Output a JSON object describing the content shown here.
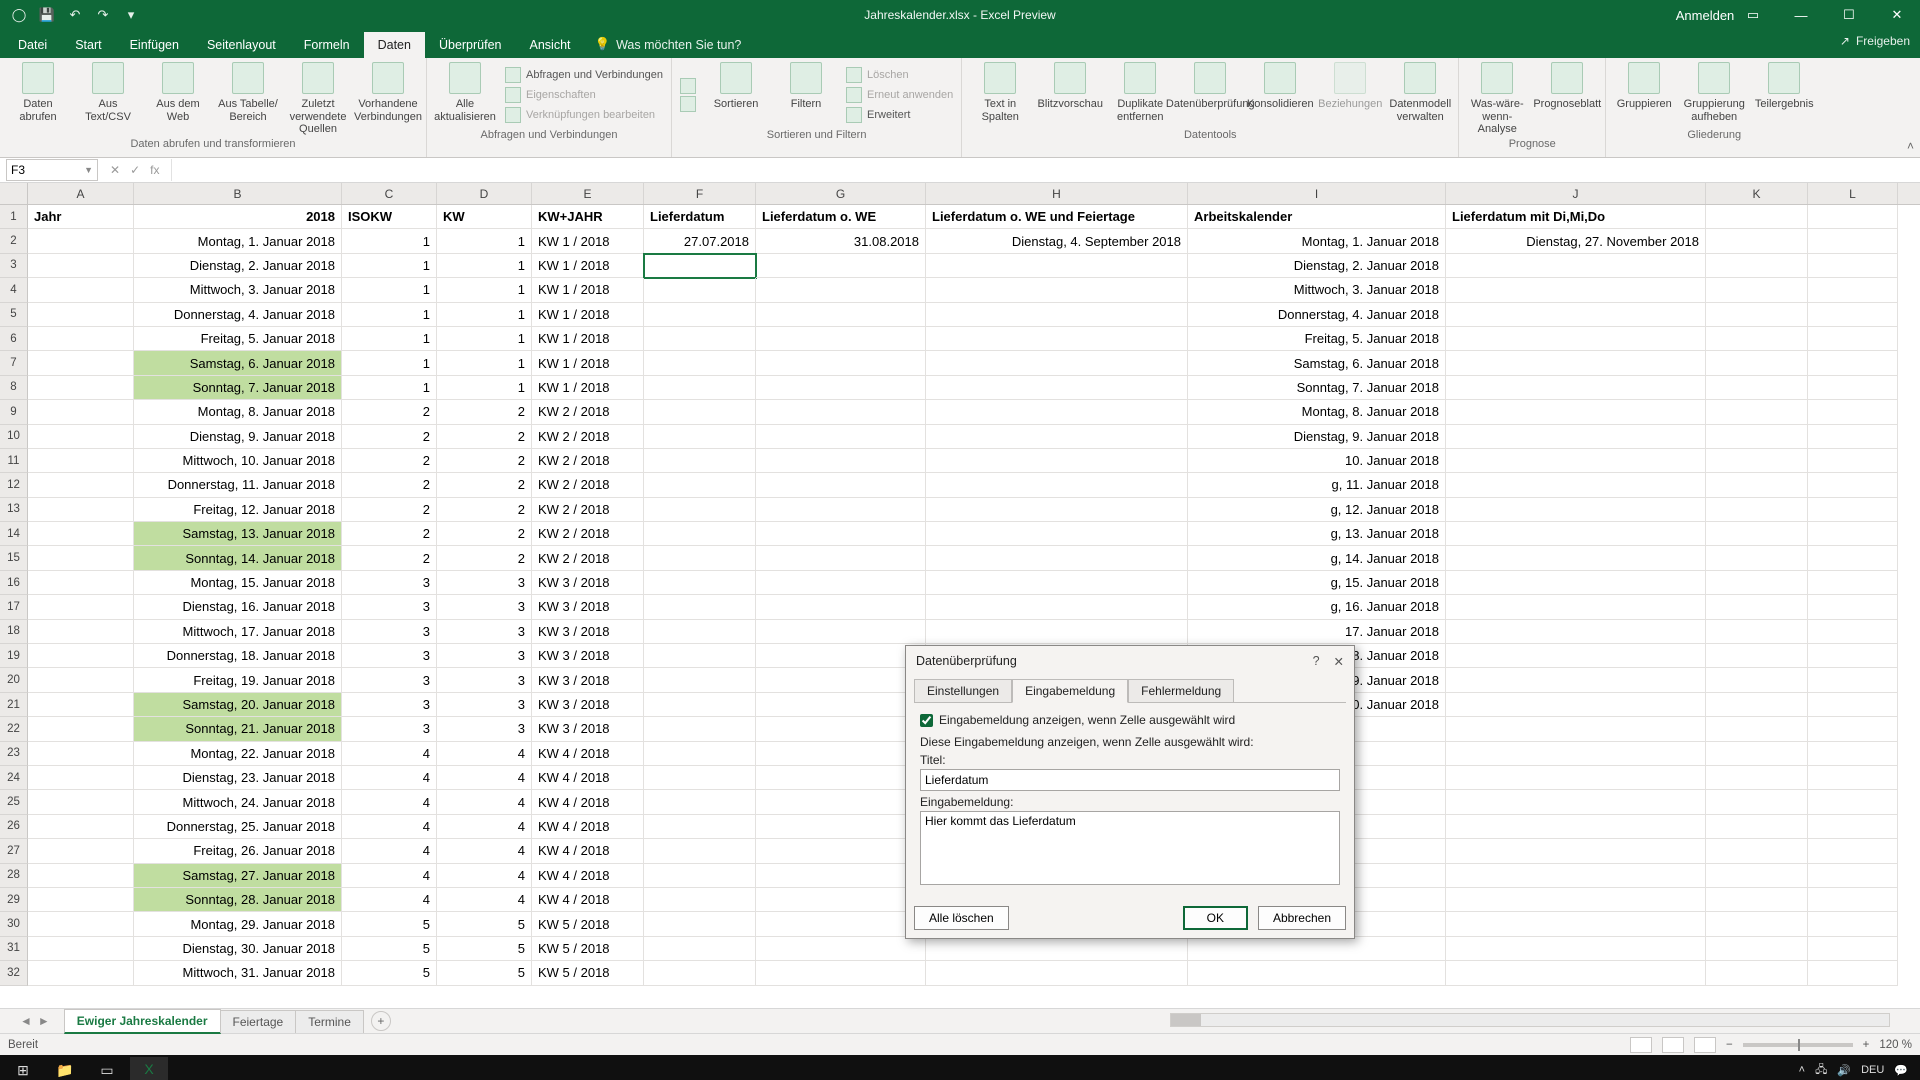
{
  "titlebar": {
    "title": "Jahreskalender.xlsx - Excel Preview",
    "signin": "Anmelden"
  },
  "tabs": {
    "datei": "Datei",
    "start": "Start",
    "einfuegen": "Einfügen",
    "seitenlayout": "Seitenlayout",
    "formeln": "Formeln",
    "daten": "Daten",
    "ueberpruefen": "Überprüfen",
    "ansicht": "Ansicht",
    "tellme": "Was möchten Sie tun?",
    "share": "Freigeben"
  },
  "ribbon": {
    "g1_label": "Daten abrufen und transformieren",
    "g1": {
      "a": "Daten abrufen",
      "b": "Aus Text/CSV",
      "c": "Aus dem Web",
      "d": "Aus Tabelle/ Bereich",
      "e": "Zuletzt verwendete Quellen",
      "f": "Vorhandene Verbindungen"
    },
    "g2_label": "Abfragen und Verbindungen",
    "g2": {
      "a": "Alle aktualisieren",
      "b": "Abfragen und Verbindungen",
      "c": "Eigenschaften",
      "d": "Verknüpfungen bearbeiten"
    },
    "g3_label": "Sortieren und Filtern",
    "g3": {
      "sortAZ": "A↓Z",
      "sortZA": "Z↓A",
      "sort": "Sortieren",
      "filter": "Filtern",
      "clear": "Löschen",
      "reapply": "Erneut anwenden",
      "advanced": "Erweitert"
    },
    "g4_label": "Datentools",
    "g4": {
      "a": "Text in Spalten",
      "b": "Blitzvorschau",
      "c": "Duplikate entfernen",
      "d": "Datenüberprüfung",
      "e": "Konsolidieren",
      "f": "Beziehungen",
      "g": "Datenmodell verwalten"
    },
    "g5_label": "Prognose",
    "g5": {
      "a": "Was-wäre-wenn-Analyse",
      "b": "Prognoseblatt"
    },
    "g6_label": "Gliederung",
    "g6": {
      "a": "Gruppieren",
      "b": "Gruppierung aufheben",
      "c": "Teilergebnis"
    }
  },
  "formula": {
    "namebox": "F3",
    "fx": "fx"
  },
  "columns": [
    "A",
    "B",
    "C",
    "D",
    "E",
    "F",
    "G",
    "H",
    "I",
    "J",
    "K",
    "L"
  ],
  "headers": {
    "A": "Jahr",
    "B": "2018",
    "C": "ISOKW",
    "D": "KW",
    "E": "KW+JAHR",
    "F": "Lieferdatum",
    "G": "Lieferdatum o. WE",
    "H": "Lieferdatum o. WE und Feiertage",
    "I": "Arbeitskalender",
    "J": "Lieferdatum mit Di,Mi,Do"
  },
  "rows": [
    {
      "n": 2,
      "B": "Montag, 1. Januar 2018",
      "C": "1",
      "D": "1",
      "E": "KW 1 / 2018",
      "F": "27.07.2018",
      "G": "31.08.2018",
      "H": "Dienstag, 4. September 2018",
      "I": "Montag, 1. Januar 2018",
      "J": "Dienstag, 27. November 2018"
    },
    {
      "n": 3,
      "B": "Dienstag, 2. Januar 2018",
      "C": "1",
      "D": "1",
      "E": "KW 1 / 2018",
      "I": "Dienstag, 2. Januar 2018",
      "sel": "F"
    },
    {
      "n": 4,
      "B": "Mittwoch, 3. Januar 2018",
      "C": "1",
      "D": "1",
      "E": "KW 1 / 2018",
      "I": "Mittwoch, 3. Januar 2018"
    },
    {
      "n": 5,
      "B": "Donnerstag, 4. Januar 2018",
      "C": "1",
      "D": "1",
      "E": "KW 1 / 2018",
      "I": "Donnerstag, 4. Januar 2018"
    },
    {
      "n": 6,
      "B": "Freitag, 5. Januar 2018",
      "C": "1",
      "D": "1",
      "E": "KW 1 / 2018",
      "I": "Freitag, 5. Januar 2018"
    },
    {
      "n": 7,
      "B": "Samstag, 6. Januar 2018",
      "C": "1",
      "D": "1",
      "E": "KW 1 / 2018",
      "I": "Samstag, 6. Januar 2018",
      "w": true
    },
    {
      "n": 8,
      "B": "Sonntag, 7. Januar 2018",
      "C": "1",
      "D": "1",
      "E": "KW 1 / 2018",
      "I": "Sonntag, 7. Januar 2018",
      "w": true
    },
    {
      "n": 9,
      "B": "Montag, 8. Januar 2018",
      "C": "2",
      "D": "2",
      "E": "KW 2 / 2018",
      "I": "Montag, 8. Januar 2018"
    },
    {
      "n": 10,
      "B": "Dienstag, 9. Januar 2018",
      "C": "2",
      "D": "2",
      "E": "KW 2 / 2018",
      "I": "Dienstag, 9. Januar 2018"
    },
    {
      "n": 11,
      "B": "Mittwoch, 10. Januar 2018",
      "C": "2",
      "D": "2",
      "E": "KW 2 / 2018",
      "I": "10. Januar 2018"
    },
    {
      "n": 12,
      "B": "Donnerstag, 11. Januar 2018",
      "C": "2",
      "D": "2",
      "E": "KW 2 / 2018",
      "I": "g, 11. Januar 2018"
    },
    {
      "n": 13,
      "B": "Freitag, 12. Januar 2018",
      "C": "2",
      "D": "2",
      "E": "KW 2 / 2018",
      "I": "g, 12. Januar 2018"
    },
    {
      "n": 14,
      "B": "Samstag, 13. Januar 2018",
      "C": "2",
      "D": "2",
      "E": "KW 2 / 2018",
      "I": "g, 13. Januar 2018",
      "w": true
    },
    {
      "n": 15,
      "B": "Sonntag, 14. Januar 2018",
      "C": "2",
      "D": "2",
      "E": "KW 2 / 2018",
      "I": "g, 14. Januar 2018",
      "w": true
    },
    {
      "n": 16,
      "B": "Montag, 15. Januar 2018",
      "C": "3",
      "D": "3",
      "E": "KW 3 / 2018",
      "I": "g, 15. Januar 2018"
    },
    {
      "n": 17,
      "B": "Dienstag, 16. Januar 2018",
      "C": "3",
      "D": "3",
      "E": "KW 3 / 2018",
      "I": "g, 16. Januar 2018"
    },
    {
      "n": 18,
      "B": "Mittwoch, 17. Januar 2018",
      "C": "3",
      "D": "3",
      "E": "KW 3 / 2018",
      "I": "17. Januar 2018"
    },
    {
      "n": 19,
      "B": "Donnerstag, 18. Januar 2018",
      "C": "3",
      "D": "3",
      "E": "KW 3 / 2018",
      "I": "g, 18. Januar 2018"
    },
    {
      "n": 20,
      "B": "Freitag, 19. Januar 2018",
      "C": "3",
      "D": "3",
      "E": "KW 3 / 2018",
      "I": "g, 19. Januar 2018"
    },
    {
      "n": 21,
      "B": "Samstag, 20. Januar 2018",
      "C": "3",
      "D": "3",
      "E": "KW 3 / 2018",
      "I": "g, 20. Januar 2018",
      "w": true
    },
    {
      "n": 22,
      "B": "Sonntag, 21. Januar 2018",
      "C": "3",
      "D": "3",
      "E": "KW 3 / 2018",
      "w": true
    },
    {
      "n": 23,
      "B": "Montag, 22. Januar 2018",
      "C": "4",
      "D": "4",
      "E": "KW 4 / 2018"
    },
    {
      "n": 24,
      "B": "Dienstag, 23. Januar 2018",
      "C": "4",
      "D": "4",
      "E": "KW 4 / 2018"
    },
    {
      "n": 25,
      "B": "Mittwoch, 24. Januar 2018",
      "C": "4",
      "D": "4",
      "E": "KW 4 / 2018"
    },
    {
      "n": 26,
      "B": "Donnerstag, 25. Januar 2018",
      "C": "4",
      "D": "4",
      "E": "KW 4 / 2018"
    },
    {
      "n": 27,
      "B": "Freitag, 26. Januar 2018",
      "C": "4",
      "D": "4",
      "E": "KW 4 / 2018"
    },
    {
      "n": 28,
      "B": "Samstag, 27. Januar 2018",
      "C": "4",
      "D": "4",
      "E": "KW 4 / 2018",
      "w": true
    },
    {
      "n": 29,
      "B": "Sonntag, 28. Januar 2018",
      "C": "4",
      "D": "4",
      "E": "KW 4 / 2018",
      "w": true
    },
    {
      "n": 30,
      "B": "Montag, 29. Januar 2018",
      "C": "5",
      "D": "5",
      "E": "KW 5 / 2018"
    },
    {
      "n": 31,
      "B": "Dienstag, 30. Januar 2018",
      "C": "5",
      "D": "5",
      "E": "KW 5 / 2018"
    },
    {
      "n": 32,
      "B": "Mittwoch, 31. Januar 2018",
      "C": "5",
      "D": "5",
      "E": "KW 5 / 2018"
    }
  ],
  "sheets": {
    "active": "Ewiger Jahreskalender",
    "t2": "Feiertage",
    "t3": "Termine"
  },
  "status": {
    "ready": "Bereit",
    "zoom": "120 %"
  },
  "dialog": {
    "title": "Datenüberprüfung",
    "tab1": "Einstellungen",
    "tab2": "Eingabemeldung",
    "tab3": "Fehlermeldung",
    "check": "Eingabemeldung anzeigen, wenn Zelle ausgewählt wird",
    "desc": "Diese Eingabemeldung anzeigen, wenn Zelle ausgewählt wird:",
    "lblTitle": "Titel:",
    "valTitle": "Lieferdatum",
    "lblMsg": "Eingabemeldung:",
    "valMsg": "Hier kommt das Lieferdatum",
    "clear": "Alle löschen",
    "ok": "OK",
    "cancel": "Abbrechen"
  },
  "tray": {
    "time": "",
    "date": ""
  }
}
